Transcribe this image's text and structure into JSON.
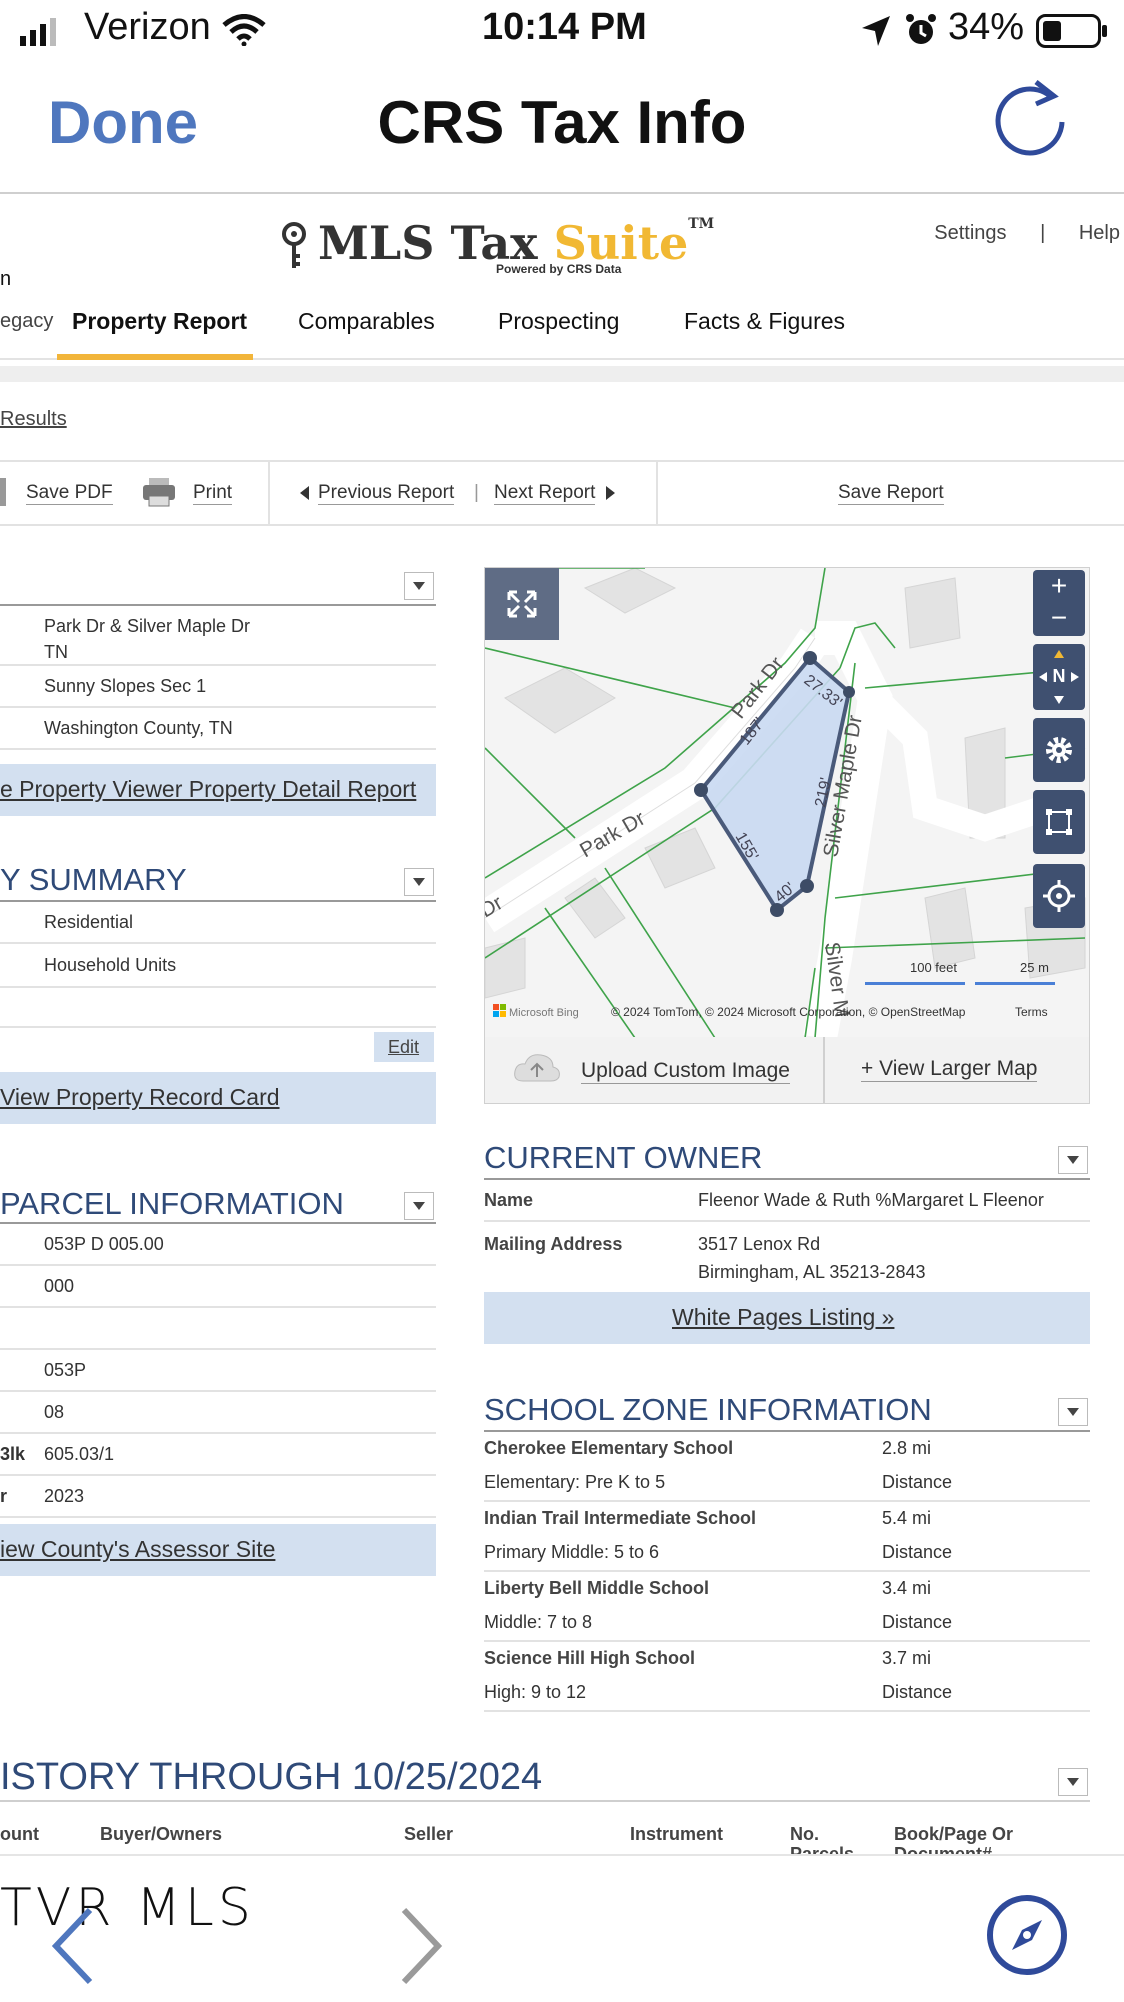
{
  "status_bar": {
    "carrier": "Verizon",
    "time": "10:14 PM",
    "battery": "34%"
  },
  "nav": {
    "done_label": "Done",
    "title": "CRS Tax Info",
    "reload_icon": "reload-icon"
  },
  "brand": {
    "logo_main": "MLS Tax ",
    "logo_accent": "Suite",
    "tm": "TM",
    "powered": "Powered by CRS Data",
    "accent_color": "#f1b833"
  },
  "top_links": {
    "settings": "Settings",
    "sep": "|",
    "help": "Help"
  },
  "tabs": [
    {
      "label": "n",
      "partial": true
    },
    {
      "label": "egacy"
    },
    {
      "label": "Property Report",
      "active": true
    },
    {
      "label": "Comparables"
    },
    {
      "label": "Prospecting"
    },
    {
      "label": "Facts & Figures"
    }
  ],
  "results_link": "Results",
  "toolbar": {
    "save_pdf": "Save PDF",
    "print": "Print",
    "previous_report": "Previous Report",
    "sep": "|",
    "next_report": "Next Report",
    "save_report": "Save Report"
  },
  "location": {
    "address_line1": "Park Dr & Silver Maple Dr",
    "address_line2": "TN",
    "subdivision": "Sunny Slopes Sec 1",
    "county": "Washington County, TN",
    "detail_link": "e Property Viewer Property Detail Report"
  },
  "summary": {
    "heading": "Y SUMMARY",
    "values": [
      "Residential",
      "Household Units"
    ],
    "edit_label": "Edit",
    "record_card_link": "View Property Record Card"
  },
  "parcel": {
    "heading": "PARCEL INFORMATION",
    "rows": [
      {
        "key": "",
        "value": "053P D 005.00"
      },
      {
        "key": "",
        "value": "000"
      },
      {
        "key": "",
        "value": ""
      },
      {
        "key": "",
        "value": "053P"
      },
      {
        "key": "",
        "value": "08"
      },
      {
        "key": "3lk",
        "value": "605.03/1"
      },
      {
        "key": "r",
        "value": "2023"
      }
    ],
    "assessor_link": "iew County's Assessor Site"
  },
  "map": {
    "streets": [
      "Park Dr",
      "Park Dr",
      "Dr",
      "Silver Maple Dr",
      "Silver M"
    ],
    "dimensions": [
      "27.33'",
      "187'",
      "219'",
      "155'",
      "40'"
    ],
    "scale_feet": "100 feet",
    "scale_m": "25 m",
    "attribution": "© 2024 TomTom, © 2024 Microsoft Corporation, © OpenStreetMap",
    "provider": "Microsoft Bing",
    "terms": "Terms",
    "zoom_in": "+",
    "zoom_out": "−",
    "compass": "N",
    "upload_label": "Upload Custom Image",
    "larger_map_label": "+ View Larger Map"
  },
  "owner": {
    "heading": "CURRENT OWNER",
    "name_label": "Name",
    "name_value": "Fleenor Wade & Ruth %Margaret L Fleenor",
    "mailing_label": "Mailing Address",
    "mailing_line1": "3517 Lenox Rd",
    "mailing_line2": "Birmingham, AL 35213-2843",
    "white_pages_link": "White Pages Listing »"
  },
  "schools": {
    "heading": "SCHOOL ZONE INFORMATION",
    "items": [
      {
        "name": "Cherokee Elementary School",
        "grades": "Elementary: Pre K to 5",
        "distance": "2.8 mi",
        "distance_label": "Distance"
      },
      {
        "name": "Indian Trail Intermediate School",
        "grades": "Primary Middle: 5 to 6",
        "distance": "5.4 mi",
        "distance_label": "Distance"
      },
      {
        "name": "Liberty Bell Middle School",
        "grades": "Middle: 7 to 8",
        "distance": "3.4 mi",
        "distance_label": "Distance"
      },
      {
        "name": "Science Hill High School",
        "grades": "High: 9 to 12",
        "distance": "3.7 mi",
        "distance_label": "Distance"
      }
    ]
  },
  "history": {
    "heading": "ISTORY THROUGH 10/25/2024",
    "columns": [
      "ount",
      "Buyer/Owners",
      "Seller",
      "Instrument",
      "No. Parcels",
      "Book/Page Or Document#"
    ]
  },
  "bottom": {
    "watermark": "TVR MLS"
  }
}
